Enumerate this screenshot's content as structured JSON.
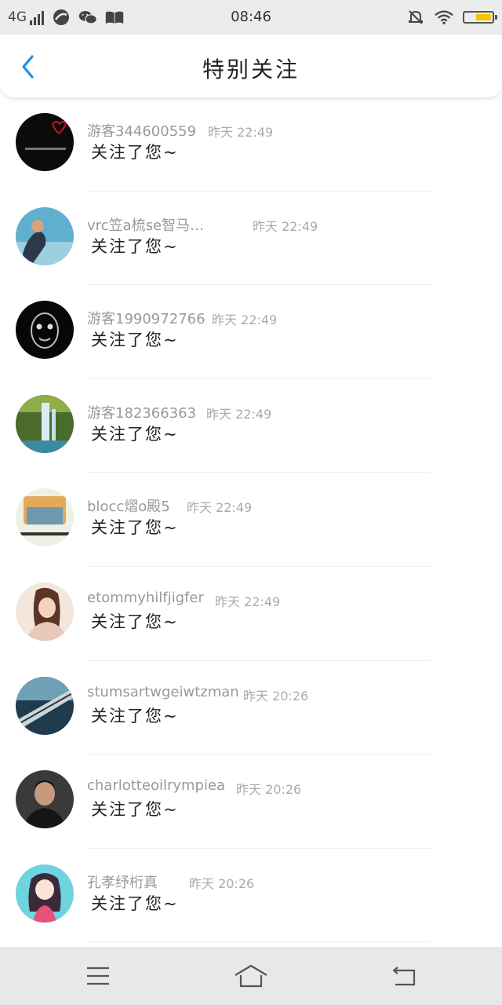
{
  "status_bar": {
    "network": "4G",
    "time": "08:46",
    "icons": [
      "signal-icon",
      "browser-icon",
      "wechat-icon",
      "book-icon",
      "mute-icon",
      "wifi-icon",
      "battery-icon"
    ],
    "battery_level": 0.6,
    "battery_color": "#f5c500"
  },
  "header": {
    "title": "特别关注",
    "back_icon": "back-chevron-icon",
    "accent": "#1e90e6"
  },
  "items": [
    {
      "name": "游客344600559",
      "time": "昨天 22:49",
      "message": "关注了您~",
      "avatar": "dark-heart-avatar"
    },
    {
      "name": "vrc笠a梳se智马…",
      "time": "昨天 22:49",
      "message": "关注了您~",
      "avatar": "blue-hand-avatar"
    },
    {
      "name": "游客1990972766",
      "time": "昨天 22:49",
      "message": "关注了您~",
      "avatar": "dark-mask-avatar"
    },
    {
      "name": "游客182366363",
      "time": "昨天 22:49",
      "message": "关注了您~",
      "avatar": "waterfall-avatar"
    },
    {
      "name": "blocc熠o殿5",
      "time": "昨天 22:49",
      "message": "关注了您~",
      "avatar": "cartoon-scene-avatar"
    },
    {
      "name": "etommyhilfjigfer",
      "time": "昨天 22:49",
      "message": "关注了您~",
      "avatar": "girl-portrait-avatar"
    },
    {
      "name": "stumsartwgeiwtzman",
      "time": "昨天 20:26",
      "message": "关注了您~",
      "avatar": "bridge-avatar"
    },
    {
      "name": "charlotteoilrympiea",
      "time": "昨天 20:26",
      "message": "关注了您~",
      "avatar": "man-portrait-avatar"
    },
    {
      "name": "孔孝纾桁真",
      "time": "昨天 20:26",
      "message": "关注了您~",
      "avatar": "anime-girl-avatar"
    }
  ],
  "nav_bar": {
    "buttons": [
      "menu-icon",
      "home-icon",
      "back-icon"
    ]
  }
}
